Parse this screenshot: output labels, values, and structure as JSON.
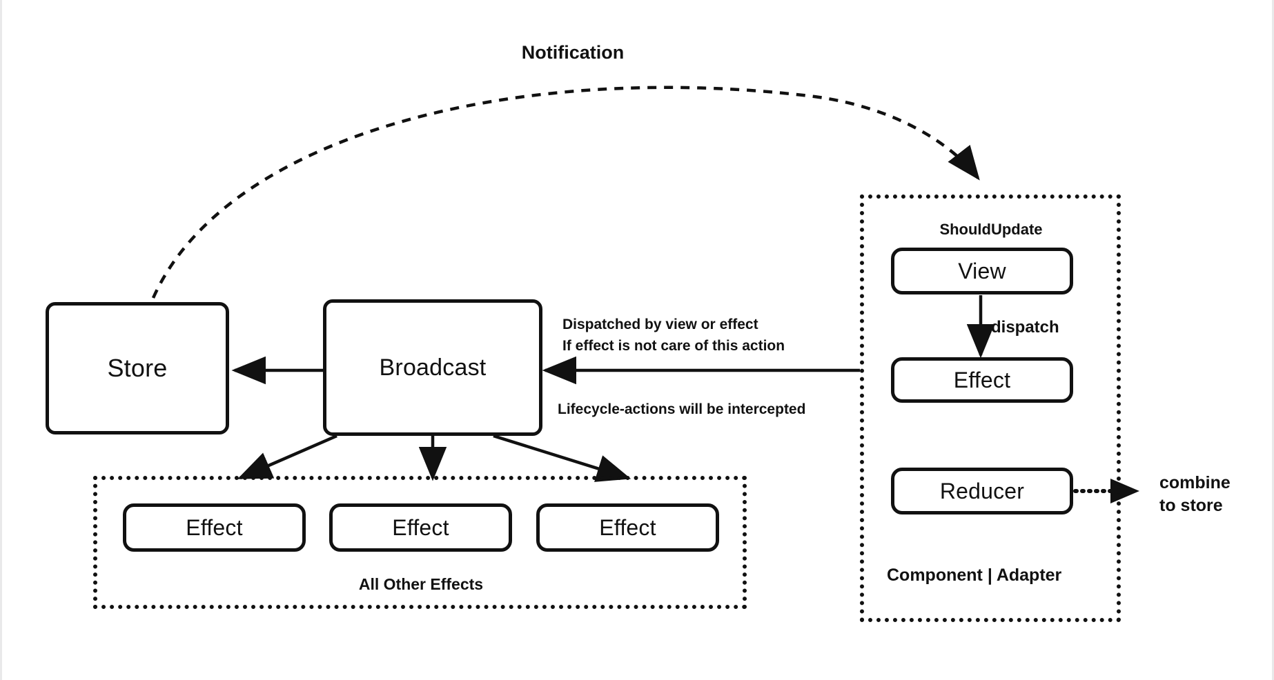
{
  "diagram": {
    "title_label": "Notification",
    "boxes": {
      "store": "Store",
      "broadcast": "Broadcast",
      "view": "View",
      "effect_right": "Effect",
      "reducer": "Reducer",
      "effect_1": "Effect",
      "effect_2": "Effect",
      "effect_3": "Effect"
    },
    "groups": {
      "all_other_effects": "All Other Effects",
      "component_adapter": "Component | Adapter"
    },
    "annotations": {
      "should_update": "ShouldUpdate",
      "dispatch": "dispatch",
      "dispatched_by": "Dispatched by view or effect",
      "if_effect_not_care": "If effect is not care of this action",
      "lifecycle_intercepted": "Lifecycle-actions will be intercepted",
      "combine_line1": "combine",
      "combine_line2": "to store"
    },
    "colors": {
      "ink": "#111111",
      "background": "#ffffff",
      "edge": "#e9e9ea"
    }
  }
}
